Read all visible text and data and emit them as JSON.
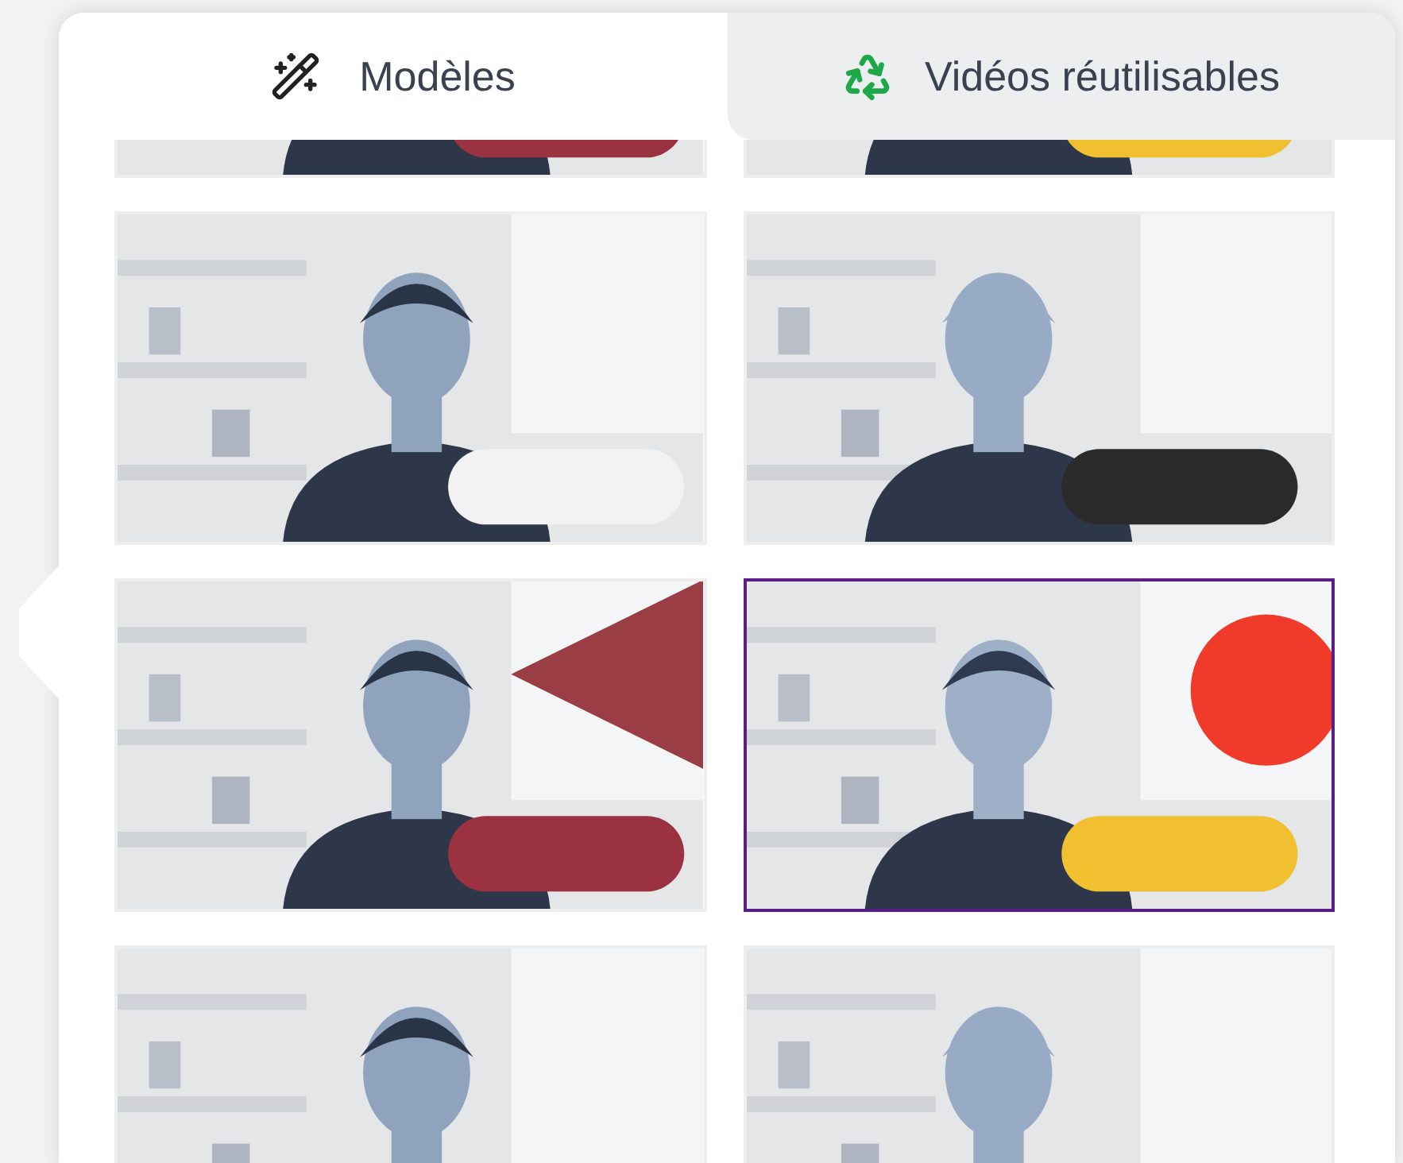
{
  "tabs": [
    {
      "label": "Modèles",
      "kind": "wand",
      "selected": true
    },
    {
      "label": "Vidéos réutilisables",
      "kind": "recycle",
      "selected": false
    }
  ],
  "thumbnails": [
    {
      "kind": "picture",
      "selected": false
    },
    {
      "kind": "picture",
      "selected": false
    },
    {
      "kind": "picture",
      "selected": false
    },
    {
      "kind": "picture",
      "selected": false
    },
    {
      "kind": "picture",
      "selected": false
    },
    {
      "kind": "picture",
      "selected": true
    },
    {
      "kind": "picture",
      "selected": false
    },
    {
      "kind": "picture",
      "selected": false
    }
  ]
}
